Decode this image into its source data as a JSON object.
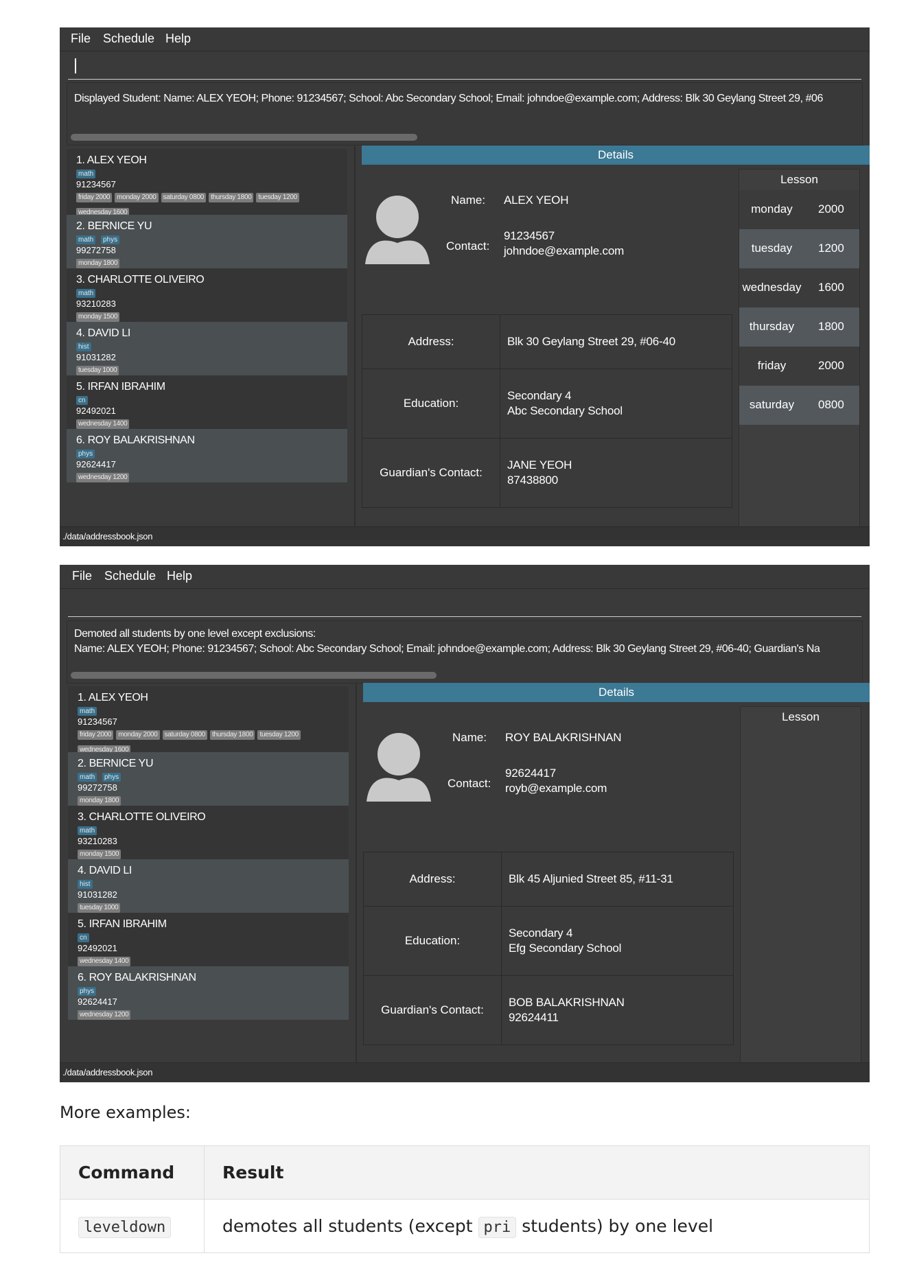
{
  "menu": [
    "File",
    "Schedule",
    "Help"
  ],
  "screens": [
    {
      "result_text": "Displayed Student: Name: ALEX YEOH; Phone: 91234567; School: Abc Secondary School; Email: johndoe@example.com; Address: Blk 30 Geylang Street 29, #06",
      "command_input": "",
      "details": {
        "header": "Details",
        "name_label": "Name:",
        "name": "ALEX YEOH",
        "contact_label": "Contact:",
        "phone": "91234567",
        "email": "johndoe@example.com",
        "address_label": "Address:",
        "address": "Blk 30 Geylang Street 29, #06-40",
        "education_label": "Education:",
        "level": "Secondary 4",
        "school": "Abc Secondary School",
        "guardian_label": "Guardian's Contact:",
        "guardian_name": "JANE YEOH",
        "guardian_phone": "87438800"
      },
      "lesson_title": "Lesson",
      "lessons": [
        {
          "day": "monday",
          "time": "2000"
        },
        {
          "day": "tuesday",
          "time": "1200"
        },
        {
          "day": "wednesday",
          "time": "1600"
        },
        {
          "day": "thursday",
          "time": "1800"
        },
        {
          "day": "friday",
          "time": "2000"
        },
        {
          "day": "saturday",
          "time": "0800"
        }
      ],
      "status": "./data/addressbook.json"
    },
    {
      "result_text": "Demoted all students by one level except exclusions:\nName: ALEX YEOH; Phone: 91234567; School: Abc Secondary School; Email: johndoe@example.com; Address: Blk 30 Geylang Street 29, #06-40; Guardian's Na",
      "command_input": "",
      "details": {
        "header": "Details",
        "name_label": "Name:",
        "name": "ROY BALAKRISHNAN",
        "contact_label": "Contact:",
        "phone": "92624417",
        "email": "royb@example.com",
        "address_label": "Address:",
        "address": "Blk 45 Aljunied Street 85, #11-31",
        "education_label": "Education:",
        "level": "Secondary 4",
        "school": "Efg Secondary School",
        "guardian_label": "Guardian's Contact:",
        "guardian_name": "BOB BALAKRISHNAN",
        "guardian_phone": "92624411"
      },
      "lesson_title": "Lesson",
      "lessons": [],
      "status": "./data/addressbook.json"
    }
  ],
  "students": [
    {
      "name": "1.  ALEX YEOH",
      "subjects": [
        "math"
      ],
      "phone": "91234567",
      "slots": [
        "friday 2000",
        "monday 2000",
        "saturday 0800",
        "thursday 1800",
        "tuesday 1200",
        "wednesday 1600"
      ]
    },
    {
      "name": "2.  BERNICE YU",
      "subjects": [
        "math",
        "phys"
      ],
      "phone": "99272758",
      "slots": [
        "monday 1800"
      ]
    },
    {
      "name": "3.  CHARLOTTE OLIVEIRO",
      "subjects": [
        "math"
      ],
      "phone": "93210283",
      "slots": [
        "monday 1500"
      ]
    },
    {
      "name": "4.  DAVID LI",
      "subjects": [
        "hist"
      ],
      "phone": "91031282",
      "slots": [
        "tuesday 1000"
      ]
    },
    {
      "name": "5.  IRFAN IBRAHIM",
      "subjects": [
        "cn"
      ],
      "phone": "92492021",
      "slots": [
        "wednesday 1400"
      ]
    },
    {
      "name": "6.  ROY BALAKRISHNAN",
      "subjects": [
        "phys"
      ],
      "phone": "92624417",
      "slots": [
        "wednesday 1200"
      ]
    }
  ],
  "more_examples": "More examples:",
  "table": {
    "headers": [
      "Command",
      "Result"
    ],
    "rows": [
      {
        "command": "leveldown",
        "result_before": "demotes all students (except ",
        "result_code": "pri",
        "result_after": " students) by one level"
      }
    ]
  },
  "colors": {
    "app_background": "#3a3a3a",
    "accent": "#3c7995",
    "subject_tag": "#3a6f89",
    "slot_tag": "#7c7c7c"
  }
}
